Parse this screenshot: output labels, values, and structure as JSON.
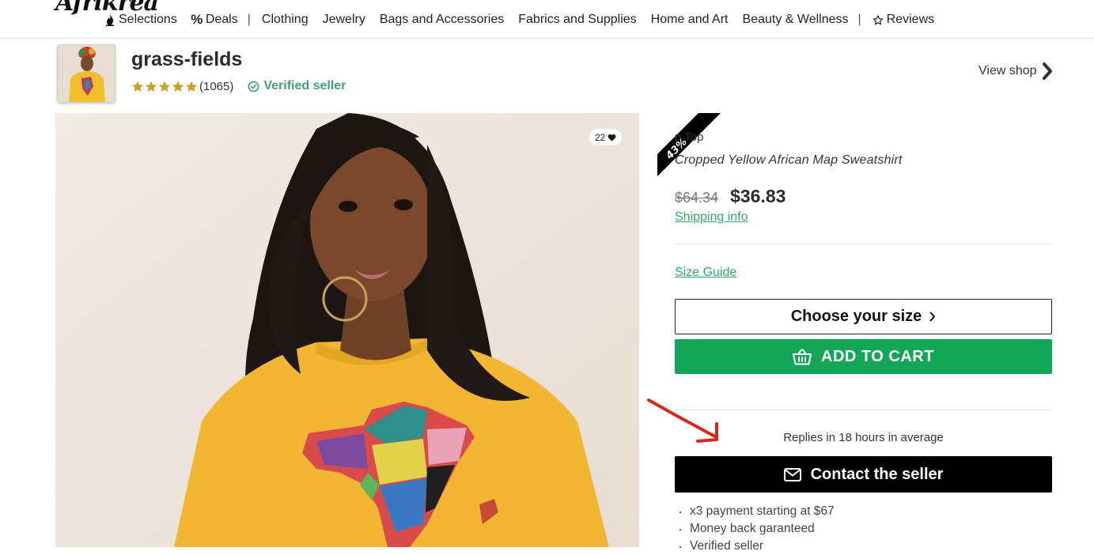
{
  "nav": {
    "items": [
      {
        "label": "Selections",
        "icon": "flame-icon"
      },
      {
        "label": "Deals",
        "icon": "percent-icon"
      },
      {
        "label": "Clothing"
      },
      {
        "label": "Jewelry"
      },
      {
        "label": "Bags and Accessories"
      },
      {
        "label": "Fabrics and Supplies"
      },
      {
        "label": "Home and Art"
      },
      {
        "label": "Beauty & Wellness"
      },
      {
        "label": "Reviews",
        "icon": "star-outline-icon"
      }
    ],
    "separator": "|"
  },
  "shop": {
    "name": "grass-fields",
    "rating_stars": 5,
    "review_count": "(1065)",
    "verified_label": "Verified seller",
    "view_shop_label": "View shop"
  },
  "product": {
    "likes": "22",
    "discount_badge": "43%",
    "brand_line": "p Top",
    "title": "Cropped Yellow African Map Sweatshirt",
    "old_price": "$64.34",
    "new_price": "$36.83",
    "shipping_info_label": "Shipping info",
    "size_guide_label": "Size Guide",
    "choose_size_label": "Choose your size",
    "add_to_cart_label": "ADD TO CART",
    "replies_text": "Replies in 18 hours in average",
    "contact_label": "Contact the seller",
    "benefits": [
      "x3 payment starting at $67",
      "Money back garanteed",
      "Verified seller"
    ]
  },
  "colors": {
    "accent_green": "#12a656",
    "link_green": "#2eab66",
    "verified_green": "#3fa56d",
    "star_gold": "#c9a227",
    "annotation_red": "#d9261c"
  }
}
